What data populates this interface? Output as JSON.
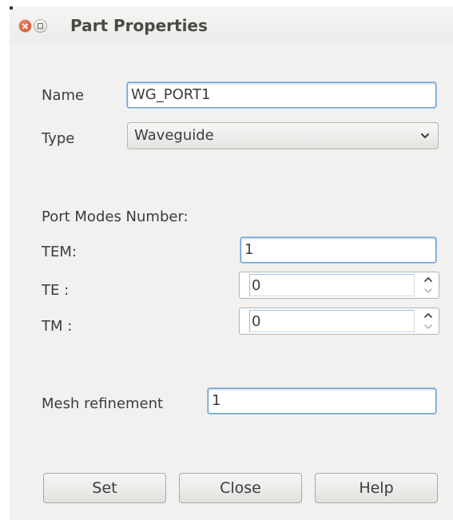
{
  "window": {
    "title": "Part Properties"
  },
  "form": {
    "name_label": "Name",
    "name_value": "WG_PORT1",
    "type_label": "Type",
    "type_value": "Waveguide",
    "port_modes_heading": "Port Modes Number:",
    "tem_label": "TEM:",
    "tem_value": "1",
    "te_label": "TE :",
    "te_value": "0",
    "tm_label": "TM :",
    "tm_value": "0",
    "mesh_label": "Mesh refinement",
    "mesh_value": "1"
  },
  "buttons": {
    "set": "Set",
    "close": "Close",
    "help": "Help"
  },
  "colors": {
    "window_bg": "#f2f1f0",
    "focus_border": "#6fa3d8",
    "close_button": "#e0532a",
    "text": "#3c3c3c"
  },
  "icons": {
    "window_close": "close-icon",
    "window_maximize": "maximize-icon",
    "combo_arrow": "chevron-down-icon",
    "spin_up": "chevron-up-icon",
    "spin_down": "chevron-down-icon"
  }
}
